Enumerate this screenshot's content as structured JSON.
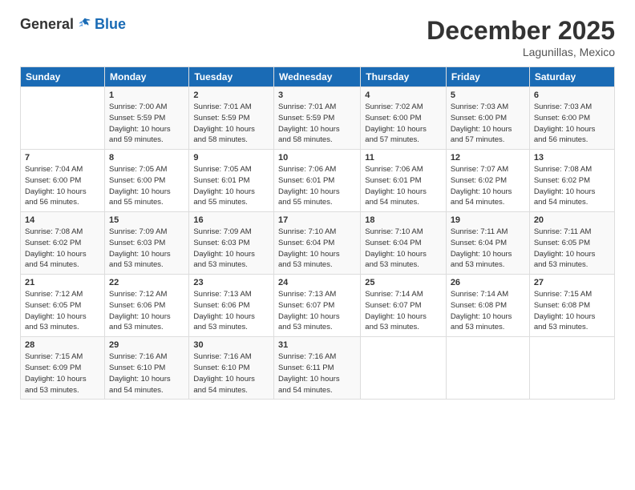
{
  "header": {
    "logo_general": "General",
    "logo_blue": "Blue",
    "title": "December 2025",
    "location": "Lagunillas, Mexico"
  },
  "days_of_week": [
    "Sunday",
    "Monday",
    "Tuesday",
    "Wednesday",
    "Thursday",
    "Friday",
    "Saturday"
  ],
  "weeks": [
    [
      {
        "day": "",
        "info": ""
      },
      {
        "day": "1",
        "info": "Sunrise: 7:00 AM\nSunset: 5:59 PM\nDaylight: 10 hours\nand 59 minutes."
      },
      {
        "day": "2",
        "info": "Sunrise: 7:01 AM\nSunset: 5:59 PM\nDaylight: 10 hours\nand 58 minutes."
      },
      {
        "day": "3",
        "info": "Sunrise: 7:01 AM\nSunset: 5:59 PM\nDaylight: 10 hours\nand 58 minutes."
      },
      {
        "day": "4",
        "info": "Sunrise: 7:02 AM\nSunset: 6:00 PM\nDaylight: 10 hours\nand 57 minutes."
      },
      {
        "day": "5",
        "info": "Sunrise: 7:03 AM\nSunset: 6:00 PM\nDaylight: 10 hours\nand 57 minutes."
      },
      {
        "day": "6",
        "info": "Sunrise: 7:03 AM\nSunset: 6:00 PM\nDaylight: 10 hours\nand 56 minutes."
      }
    ],
    [
      {
        "day": "7",
        "info": "Sunrise: 7:04 AM\nSunset: 6:00 PM\nDaylight: 10 hours\nand 56 minutes."
      },
      {
        "day": "8",
        "info": "Sunrise: 7:05 AM\nSunset: 6:00 PM\nDaylight: 10 hours\nand 55 minutes."
      },
      {
        "day": "9",
        "info": "Sunrise: 7:05 AM\nSunset: 6:01 PM\nDaylight: 10 hours\nand 55 minutes."
      },
      {
        "day": "10",
        "info": "Sunrise: 7:06 AM\nSunset: 6:01 PM\nDaylight: 10 hours\nand 55 minutes."
      },
      {
        "day": "11",
        "info": "Sunrise: 7:06 AM\nSunset: 6:01 PM\nDaylight: 10 hours\nand 54 minutes."
      },
      {
        "day": "12",
        "info": "Sunrise: 7:07 AM\nSunset: 6:02 PM\nDaylight: 10 hours\nand 54 minutes."
      },
      {
        "day": "13",
        "info": "Sunrise: 7:08 AM\nSunset: 6:02 PM\nDaylight: 10 hours\nand 54 minutes."
      }
    ],
    [
      {
        "day": "14",
        "info": "Sunrise: 7:08 AM\nSunset: 6:02 PM\nDaylight: 10 hours\nand 54 minutes."
      },
      {
        "day": "15",
        "info": "Sunrise: 7:09 AM\nSunset: 6:03 PM\nDaylight: 10 hours\nand 53 minutes."
      },
      {
        "day": "16",
        "info": "Sunrise: 7:09 AM\nSunset: 6:03 PM\nDaylight: 10 hours\nand 53 minutes."
      },
      {
        "day": "17",
        "info": "Sunrise: 7:10 AM\nSunset: 6:04 PM\nDaylight: 10 hours\nand 53 minutes."
      },
      {
        "day": "18",
        "info": "Sunrise: 7:10 AM\nSunset: 6:04 PM\nDaylight: 10 hours\nand 53 minutes."
      },
      {
        "day": "19",
        "info": "Sunrise: 7:11 AM\nSunset: 6:04 PM\nDaylight: 10 hours\nand 53 minutes."
      },
      {
        "day": "20",
        "info": "Sunrise: 7:11 AM\nSunset: 6:05 PM\nDaylight: 10 hours\nand 53 minutes."
      }
    ],
    [
      {
        "day": "21",
        "info": "Sunrise: 7:12 AM\nSunset: 6:05 PM\nDaylight: 10 hours\nand 53 minutes."
      },
      {
        "day": "22",
        "info": "Sunrise: 7:12 AM\nSunset: 6:06 PM\nDaylight: 10 hours\nand 53 minutes."
      },
      {
        "day": "23",
        "info": "Sunrise: 7:13 AM\nSunset: 6:06 PM\nDaylight: 10 hours\nand 53 minutes."
      },
      {
        "day": "24",
        "info": "Sunrise: 7:13 AM\nSunset: 6:07 PM\nDaylight: 10 hours\nand 53 minutes."
      },
      {
        "day": "25",
        "info": "Sunrise: 7:14 AM\nSunset: 6:07 PM\nDaylight: 10 hours\nand 53 minutes."
      },
      {
        "day": "26",
        "info": "Sunrise: 7:14 AM\nSunset: 6:08 PM\nDaylight: 10 hours\nand 53 minutes."
      },
      {
        "day": "27",
        "info": "Sunrise: 7:15 AM\nSunset: 6:08 PM\nDaylight: 10 hours\nand 53 minutes."
      }
    ],
    [
      {
        "day": "28",
        "info": "Sunrise: 7:15 AM\nSunset: 6:09 PM\nDaylight: 10 hours\nand 53 minutes."
      },
      {
        "day": "29",
        "info": "Sunrise: 7:16 AM\nSunset: 6:10 PM\nDaylight: 10 hours\nand 54 minutes."
      },
      {
        "day": "30",
        "info": "Sunrise: 7:16 AM\nSunset: 6:10 PM\nDaylight: 10 hours\nand 54 minutes."
      },
      {
        "day": "31",
        "info": "Sunrise: 7:16 AM\nSunset: 6:11 PM\nDaylight: 10 hours\nand 54 minutes."
      },
      {
        "day": "",
        "info": ""
      },
      {
        "day": "",
        "info": ""
      },
      {
        "day": "",
        "info": ""
      }
    ]
  ]
}
